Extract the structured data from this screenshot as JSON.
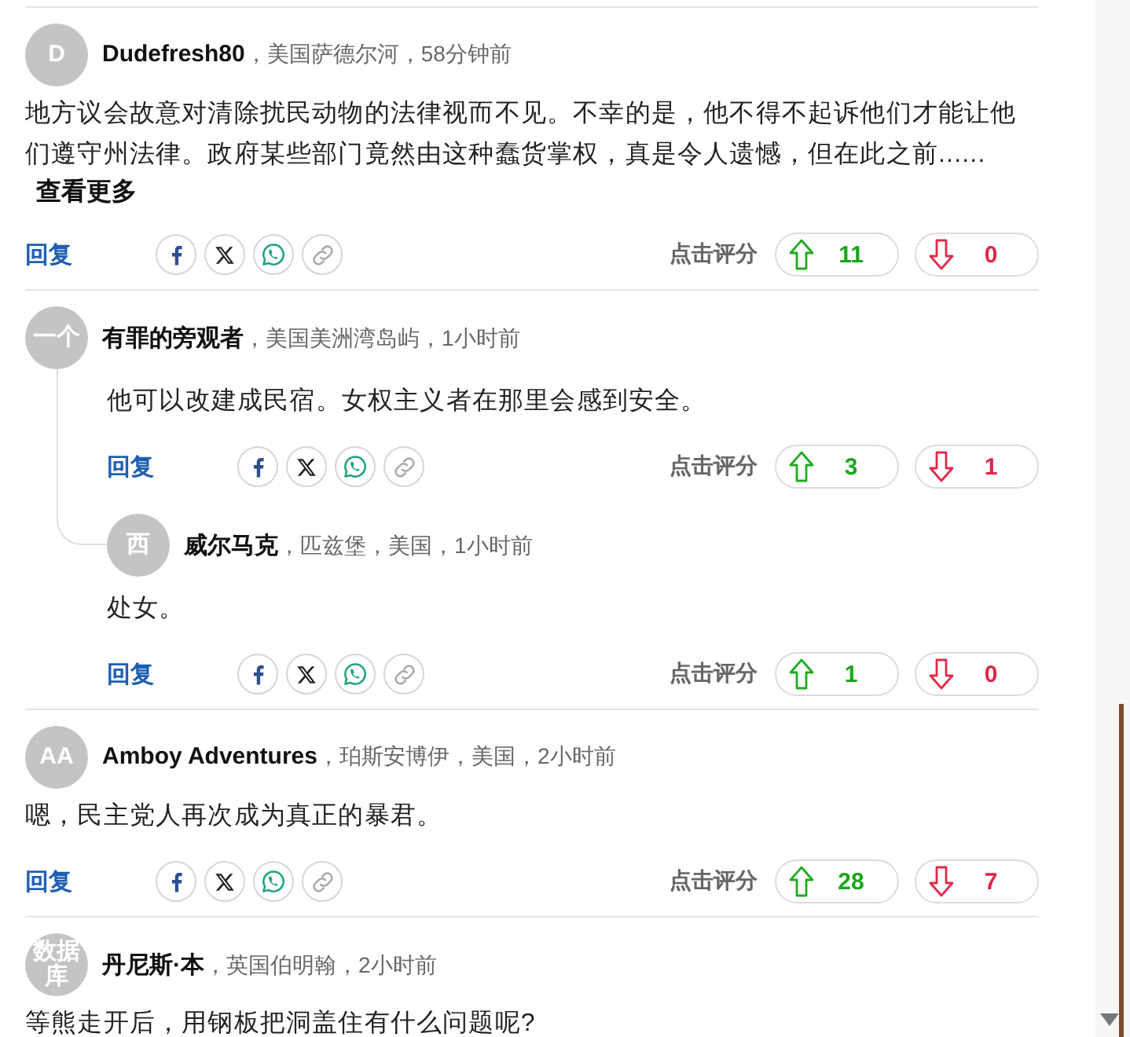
{
  "comments": [
    {
      "avatar_text": "D",
      "author": "Dudefresh80",
      "meta": "，美国萨德尔河，58分钟前",
      "body": "地方议会故意对清除扰民动物的法律视而不见。不幸的是，他不得不起诉他们才能让他们遵守州法律。政府某些部门竟然由这种蠢货掌权，真是令人遗憾，但在此之前......",
      "see_more": "查看更多",
      "reply_label": "回复",
      "rate_label": "点击评分",
      "votes": {
        "up": "11",
        "down": "0"
      }
    },
    {
      "avatar_text": "一个",
      "author": "有罪的旁观者",
      "meta": "，美国美洲湾岛屿，1小时前",
      "body": "他可以改建成民宿。女权主义者在那里会感到安全。",
      "reply_label": "回复",
      "rate_label": "点击评分",
      "votes": {
        "up": "3",
        "down": "1"
      },
      "replies": [
        {
          "avatar_text": "西",
          "author": "威尔马克",
          "meta": "，匹兹堡，美国，1小时前",
          "body": "处女。",
          "reply_label": "回复",
          "rate_label": "点击评分",
          "votes": {
            "up": "1",
            "down": "0"
          }
        }
      ]
    },
    {
      "avatar_text": "AA",
      "author": "Amboy Adventures",
      "meta": "，珀斯安博伊，美国，2小时前",
      "body": "嗯，民主党人再次成为真正的暴君。",
      "reply_label": "回复",
      "rate_label": "点击评分",
      "votes": {
        "up": "28",
        "down": "7"
      }
    },
    {
      "avatar_text": "数据库",
      "author": "丹尼斯·本",
      "meta": "，英国伯明翰，2小时前",
      "body": "等熊走开后，用钢板把洞盖住有什么问题呢?"
    }
  ]
}
